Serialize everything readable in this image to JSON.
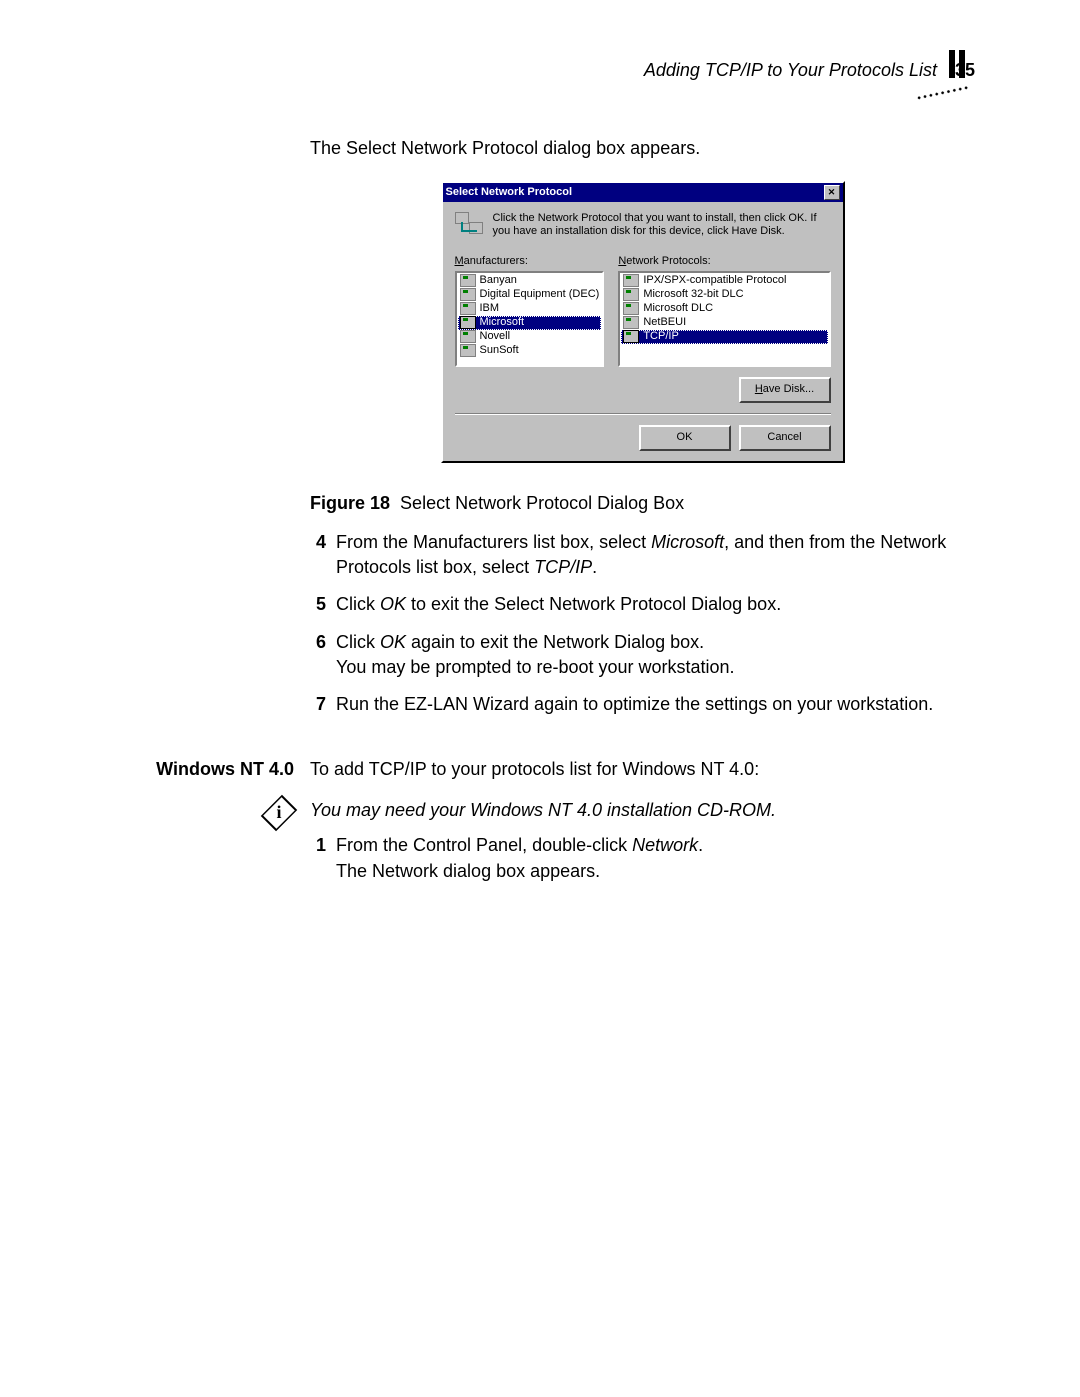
{
  "header": {
    "title": "Adding TCP/IP to Your Protocols List",
    "page": "35"
  },
  "intro": "The Select Network Protocol dialog box appears.",
  "dialog": {
    "title": "Select Network Protocol",
    "close": "✕",
    "instruction": "Click the Network Protocol that you want to install, then click OK. If you have an installation disk for this device, click Have Disk.",
    "manufacturers_label_pre": "M",
    "manufacturers_label_post": "anufacturers:",
    "protocols_label_pre": "N",
    "protocols_label_post": "etwork Protocols:",
    "manufacturers": [
      "Banyan",
      "Digital Equipment (DEC)",
      "IBM",
      "Microsoft",
      "Novell",
      "SunSoft"
    ],
    "manufacturers_selected_index": 3,
    "protocols": [
      "IPX/SPX-compatible Protocol",
      "Microsoft 32-bit DLC",
      "Microsoft DLC",
      "NetBEUI",
      "TCP/IP"
    ],
    "protocols_selected_index": 4,
    "have_disk_pre": "H",
    "have_disk_post": "ave Disk...",
    "ok": "OK",
    "cancel": "Cancel"
  },
  "figure": {
    "label": "Figure 18",
    "caption": "Select Network Protocol Dialog Box"
  },
  "steps_a": [
    {
      "num": "4",
      "html": "From the Manufacturers list box, select <i>Microsoft</i>, and then from the Network Protocols list box, select <i>TCP/IP</i>."
    },
    {
      "num": "5",
      "html": "Click <i>OK</i> to exit the Select Network Protocol Dialog box."
    },
    {
      "num": "6",
      "html": "Click <i>OK</i> again to exit the Network Dialog box.<br>You may be prompted to re-boot your workstation."
    },
    {
      "num": "7",
      "html": "Run the EZ-LAN Wizard again to optimize the settings on your workstation."
    }
  ],
  "nt": {
    "heading": "Windows NT 4.0",
    "intro": "To add TCP/IP to your protocols list for Windows NT 4.0:",
    "note": "You may need your Windows NT 4.0 installation CD-ROM.",
    "steps": [
      {
        "num": "1",
        "html": "From the Control Panel, double-click <i>Network</i>.<br>The Network dialog box appears."
      }
    ]
  }
}
